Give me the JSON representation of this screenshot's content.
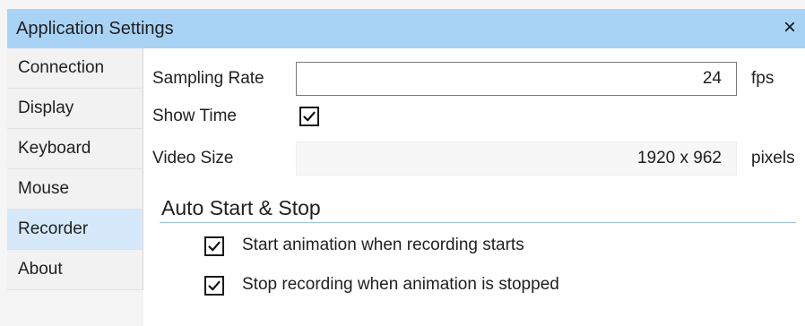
{
  "window": {
    "title": "Application Settings",
    "close_glyph": "×"
  },
  "sidebar": {
    "items": [
      {
        "label": "Connection",
        "selected": false
      },
      {
        "label": "Display",
        "selected": false
      },
      {
        "label": "Keyboard",
        "selected": false
      },
      {
        "label": "Mouse",
        "selected": false
      },
      {
        "label": "Recorder",
        "selected": true
      },
      {
        "label": "About",
        "selected": false
      }
    ]
  },
  "recorder": {
    "sampling_rate": {
      "label": "Sampling Rate",
      "value": "24",
      "unit": "fps"
    },
    "show_time": {
      "label": "Show Time",
      "checked": true
    },
    "video_size": {
      "label": "Video Size",
      "value": "1920 x 962",
      "unit": "pixels"
    },
    "auto_start_stop": {
      "title": "Auto Start & Stop",
      "options": [
        {
          "label": "Start animation when recording starts",
          "checked": true
        },
        {
          "label": "Stop recording when animation is stopped",
          "checked": true
        }
      ]
    }
  },
  "colors": {
    "titlebar": "#a9d3f5",
    "selected_item": "#d5e9fb",
    "section_rule": "#9ac3e6"
  }
}
